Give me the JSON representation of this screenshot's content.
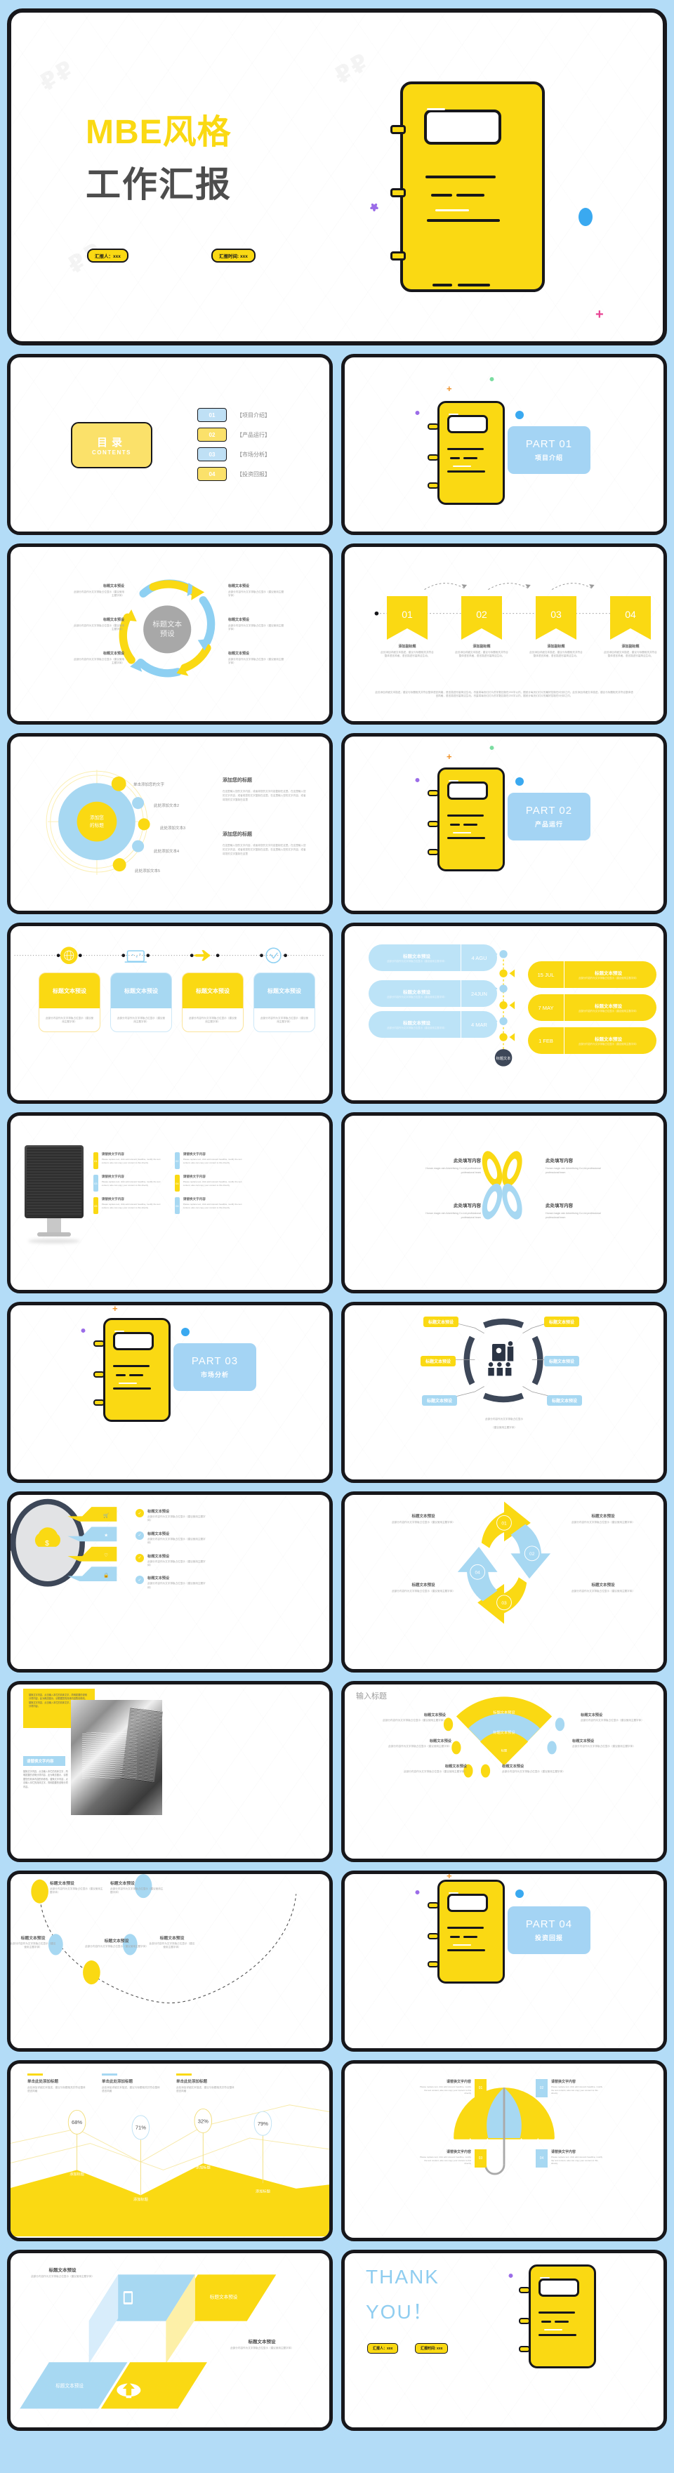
{
  "theme": {
    "yellow": "#fad913",
    "blue": "#a4d4f4",
    "dark": "#17171b",
    "bg": "#b3dcf7",
    "gray": "#8f8f8f"
  },
  "cover": {
    "title_yellow": "MBE风格",
    "title_dark": "工作汇报",
    "tag_presenter": "汇报人：xxx",
    "tag_date": "汇报时间: xxx"
  },
  "contents": {
    "label_cn": "目录",
    "label_en": "CONTENTS",
    "items": [
      {
        "num": "01",
        "text": "【项目介绍】",
        "color": "blue"
      },
      {
        "num": "02",
        "text": "【产品运行】",
        "color": "yellow"
      },
      {
        "num": "03",
        "text": "【市场分析】",
        "color": "blue"
      },
      {
        "num": "04",
        "text": "【投资回报】",
        "color": "yellow"
      }
    ]
  },
  "parts": [
    {
      "num": "PART 01",
      "title": "项目介绍"
    },
    {
      "num": "PART 02",
      "title": "产品运行"
    },
    {
      "num": "PART 03",
      "title": "市场分析"
    },
    {
      "num": "PART 04",
      "title": "投资回报"
    }
  ],
  "common": {
    "preset_title": "标题文本预设",
    "preset_body": "此部分内容作为文字排版占位显示（建议使用主题字体）",
    "preset_body_l1": "此部分内容作为文字排版占",
    "preset_body_l2": "位显示（建议使用主题字体）",
    "add_subtitle": "添加副标题",
    "add_title": "添加标题",
    "replace_text": "请替换文字内容",
    "fill_here": "此处填写内容",
    "input_title": "输入标题",
    "your_title": "添加您的标题",
    "click_add_text": "单击添加您的文字",
    "detail_desc": "此处添加详细文本描述，建议与标题相关并符合整体语言风格，语言描述尽量简洁生动。",
    "en_body": "Please replace text, click add relevant headline, modify the text content, also can copy your content to this directly",
    "en_team": "Hunan magic rain Advertising Co.Ltd.professional professional team"
  },
  "swirl_slide": {
    "center": "标题文本\n预设",
    "items": [
      {
        "title": "标题文本预设",
        "body": "此部分内容作为文字排版占位显示（建议使用主题字体）"
      },
      {
        "title": "标题文本预设",
        "body": "此部分内容作为文字排版占位显示（建议使用主题字体）"
      },
      {
        "title": "标题文本预设",
        "body": "此部分内容作为文字排版占位显示（建议使用主题字体）"
      },
      {
        "title": "标题文本预设",
        "body": "此部分内容作为文字排版占位显示（建议使用主题字体）"
      },
      {
        "title": "标题文本预设",
        "body": "此部分内容作为文字排版占位显示（建议使用主题字体）"
      },
      {
        "title": "标题文本预设",
        "body": "此部分内容作为文字排版占位显示（建议使用主题字体）"
      }
    ]
  },
  "banner_slide": {
    "items": [
      {
        "num": "01",
        "subtitle": "添加副标题",
        "body": "此处添加详细文本描述，建议与标题相关并符合整体语言风格，语言描述尽量简洁生动。"
      },
      {
        "num": "02",
        "subtitle": "添加副标题",
        "body": "此处添加详细文本描述，建议与标题相关并符合整体语言风格，语言描述尽量简洁生动。"
      },
      {
        "num": "03",
        "subtitle": "添加副标题",
        "body": "此处添加详细文本描述，建议与标题相关并符合整体语言风格，语言描述尽量简洁生动。"
      },
      {
        "num": "04",
        "subtitle": "添加副标题",
        "body": "此处添加详细文本描述，建议与标题相关并符合整体语言风格，语言描述尽量简洁生动。"
      }
    ],
    "footer": "此处添加详细文本描述，建议与标题相关并符合整体语言风格，语言描述尽量简洁生动。尽量将每页幻灯片的字数控制在200字以内，据统计每页幻灯片的最好控制在5分钟之内。此处添加详细文本描述，建议与标题相关并符合整体语言风格，语言描述尽量简洁生动。尽量将每页幻灯片的字数控制在200字以内，据统计每页幻灯片的最好控制在5分钟之内。"
  },
  "bubble_slide": {
    "center": "添加您\n的标题",
    "labels": [
      {
        "text": "单击添加您的文字",
        "color": "yellow"
      },
      {
        "text": "此处添加文本2",
        "color": "blue"
      },
      {
        "text": "此处添加文本3",
        "color": "yellow"
      },
      {
        "text": "此处添加文本4",
        "color": "blue"
      },
      {
        "text": "此处添加文本5",
        "color": "yellow"
      }
    ],
    "blocks": [
      {
        "title": "添加您的标题",
        "body": "在这里输入您的文字内容，或者将您的文字内容复制在这里。在这里输入您的文字内容，或者将您的文字复制在这里。在这里输入您的文字内容。或者将您的文字复制在这里"
      },
      {
        "title": "添加您的标题",
        "body": "在这里输入您的文字内容，或者将您的文字内容复制在这里。在这里输入您的文字内容，或者将您的文字复制在这里。在这里输入您的文字内容。或者将您的文字复制在这里"
      }
    ]
  },
  "icon_timeline": {
    "cards": [
      {
        "title": "标题文本预设",
        "body": "此部分内容作为文字排版占位显示（建议使用主题字体）",
        "color": "yellow",
        "icon": "globe-icon"
      },
      {
        "title": "标题文本预设",
        "body": "此部分内容作为文字排版占位显示（建议使用主题字体）",
        "color": "blue",
        "icon": "laptop-icon"
      },
      {
        "title": "标题文本预设",
        "body": "此部分内容作为文字排版占位显示（建议使用主题字体）",
        "color": "yellow",
        "icon": "airplane-icon"
      },
      {
        "title": "标题文本预设",
        "body": "此部分内容作为文字排版占位显示（建议使用主题字体）",
        "color": "blue",
        "icon": "clock-icon"
      }
    ]
  },
  "date_timeline": {
    "center_label": "标题文本",
    "left": [
      {
        "date": "4 AGU",
        "title": "标题文本预设",
        "body": "此部分内容作为文字排版占位显示（建议使用主题字体）"
      },
      {
        "date": "24JUN",
        "title": "标题文本预设",
        "body": "此部分内容作为文字排版占位显示（建议使用主题字体）"
      },
      {
        "date": "4 MAR",
        "title": "标题文本预设",
        "body": "此部分内容作为文字排版占位显示（建议使用主题字体）"
      }
    ],
    "right": [
      {
        "date": "15 JUL",
        "title": "标题文本预设",
        "body": "此部分内容作为文字排版占位显示（建议使用主题字体）"
      },
      {
        "date": "7 MAY",
        "title": "标题文本预设",
        "body": "此部分内容作为文字排版占位显示（建议使用主题字体）"
      },
      {
        "date": "1 FEB",
        "title": "标题文本预设",
        "body": "此部分内容作为文字排版占位显示（建议使用主题字体）"
      }
    ]
  },
  "monitor_slide": {
    "items": [
      {
        "num": "01",
        "title": "请替换文字内容",
        "body": "Please replace text, click add relevant headline, modify the text content, also can copy your content to this directly",
        "color": "yellow"
      },
      {
        "num": "02",
        "title": "请替换文字内容",
        "body": "Please replace text, click add relevant headline, modify the text content, also can copy your content to this directly",
        "color": "blue"
      },
      {
        "num": "03",
        "title": "请替换文字内容",
        "body": "Please replace text, click add relevant headline, modify the text content, also can copy your content to this directly",
        "color": "blue"
      },
      {
        "num": "04",
        "title": "请替换文字内容",
        "body": "Please replace text, click add relevant headline, modify the text content, also can copy your content to this directly",
        "color": "yellow"
      },
      {
        "num": "05",
        "title": "请替换文字内容",
        "body": "Please replace text, click add relevant headline, modify the text content, also can copy your content to this directly",
        "color": "yellow"
      },
      {
        "num": "06",
        "title": "请替换文字内容",
        "body": "Please replace text, click add relevant headline, modify the text content, also can copy your content to this directly",
        "color": "blue"
      }
    ]
  },
  "petal_slide": {
    "items": [
      {
        "title": "此处填写内容",
        "body": "Hunan magic rain Advertising Co.Ltd.professional professional team"
      },
      {
        "title": "此处填写内容",
        "body": "Hunan magic rain Advertising Co.Ltd.professional professional team"
      },
      {
        "title": "此处填写内容",
        "body": "Hunan magic rain Advertising Co.Ltd.professional professional team"
      },
      {
        "title": "此处填写内容",
        "body": "Hunan magic rain Advertising Co.Ltd.professional professional team"
      }
    ]
  },
  "hub_slide": {
    "tags": [
      {
        "text": "标题文本预设",
        "color": "yellow"
      },
      {
        "text": "标题文本预设",
        "color": "yellow"
      },
      {
        "text": "标题文本预设",
        "color": "yellow"
      },
      {
        "text": "标题文本预设",
        "color": "blue"
      },
      {
        "text": "标题文本预设",
        "color": "blue"
      },
      {
        "text": "标题文本预设",
        "color": "blue"
      }
    ],
    "caption_l1": "此部分内容作为文字排版占位显示",
    "caption_l2": "（建议使用主题字体）"
  },
  "magnifier_slide": {
    "items": [
      {
        "title": "标题文本预设",
        "body": "此部分内容作为文字排版占位显示（建议使用主题字体）",
        "color": "yellow"
      },
      {
        "title": "标题文本预设",
        "body": "此部分内容作为文字排版占位显示（建议使用主题字体）",
        "color": "blue"
      },
      {
        "title": "标题文本预设",
        "body": "此部分内容作为文字排版占位显示（建议使用主题字体）",
        "color": "yellow"
      },
      {
        "title": "标题文本预设",
        "body": "此部分内容作为文字排版占位显示（建议使用主题字体）",
        "color": "blue"
      }
    ]
  },
  "cycle_slide": {
    "items": [
      {
        "num": "01",
        "title": "标题文本预设",
        "body": "此部分内容作为文字排版占位显示（建议使用主题字体）",
        "color": "yellow"
      },
      {
        "num": "02",
        "title": "标题文本预设",
        "body": "此部分内容作为文字排版占位显示（建议使用主题字体）",
        "color": "blue"
      },
      {
        "num": "03",
        "title": "标题文本预设",
        "body": "此部分内容作为文字排版占位显示（建议使用主题字体）",
        "color": "yellow"
      },
      {
        "num": "04",
        "title": "标题文本预设",
        "body": "此部分内容作为文字排版占位显示（建议使用主题字体）",
        "color": "blue"
      }
    ]
  },
  "photo_slide": {
    "yellow_block": "替换文字内容、点击输入本栏的具体文字，简明扼要的说明分项内容，此为概念图示，请根据您的具体内容酌情修改。替换文字内容、点击输入本栏的具体文字，简明扼要的说明分项内容。",
    "blue_title": "请替换文字内容",
    "blue_body": "替换文字内容，点击输入本栏的具体文字，简明扼要的说明分项内容，此为概念图示，请根据您的具体内容酌情修改。替换文字内容，点击输入本栏的具体文字，简明扼要的说明分项内容。"
  },
  "fan_slide": {
    "heading": "输入标题",
    "fan_labels": [
      "标题文本预设",
      "标题文本预设",
      "标题"
    ],
    "items": [
      {
        "title": "标题文本预设",
        "body": "此部分内容作为文字排版占位显示（建议使用主题字体）",
        "color": "yellow"
      },
      {
        "title": "标题文本预设",
        "body": "此部分内容作为文字排版占位显示（建议使用主题字体）",
        "color": "blue"
      },
      {
        "title": "标题文本预设",
        "body": "此部分内容作为文字排版占位显示（建议使用主题字体）",
        "color": "yellow"
      },
      {
        "title": "标题文本预设",
        "body": "此部分内容作为文字排版占位显示（建议使用主题字体）",
        "color": "blue"
      },
      {
        "title": "标题文本预设",
        "body": "此部分内容作为文字排版占位显示（建议使用主题字体）",
        "color": "yellow"
      },
      {
        "title": "标题文本预设",
        "body": "此部分内容作为文字排版占位显示（建议使用主题字体）",
        "color": "yellow"
      }
    ]
  },
  "arc_slide": {
    "items": [
      {
        "title": "标题文本预设",
        "body": "此部分内容作为文字排版占位显示（建议使用主题字体）",
        "color": "yellow"
      },
      {
        "title": "标题文本预设",
        "body": "此部分内容作为文字排版占位显示（建议使用主题字体）",
        "color": "blue"
      },
      {
        "title": "标题文本预设",
        "body": "此部分内容作为文字排版占位显示（建议使用主题字体）",
        "color": "blue"
      },
      {
        "title": "标题文本预设",
        "body": "此部分内容作为文字排版占位显示（建议使用主题字体）",
        "color": "blue"
      },
      {
        "title": "标题文本预设",
        "body": "此部分内容作为文字排版占位显示（建议使用主题字体）",
        "color": "yellow"
      }
    ]
  },
  "chart_data": {
    "type": "line",
    "title": "",
    "categories": [
      "添加标题",
      "添加标题",
      "添加标题",
      "添加标题"
    ],
    "values": [
      68,
      71,
      32,
      79
    ],
    "value_labels": [
      "68%",
      "71%",
      "32%",
      "79%"
    ],
    "ylabel": "",
    "xlabel": "",
    "ylim": [
      0,
      100
    ],
    "grid": false,
    "legend": "none",
    "headers": [
      {
        "title": "单击此处添加标题",
        "body": "此处添加详细文本描述，建议与标题相关并符合整体语言风格",
        "color": "yellow"
      },
      {
        "title": "单击此处添加标题",
        "body": "此处添加详细文本描述，建议与标题相关并符合整体语言风格",
        "color": "blue"
      },
      {
        "title": "单击此处添加标题",
        "body": "此处添加详细文本描述，建议与标题相关并符合整体语言风格",
        "color": "yellow"
      }
    ]
  },
  "umbrella_slide": {
    "items": [
      {
        "num": "01",
        "title": "请替换文字内容",
        "body": "Please replace text, click add relevant headline, modify the text content, also can copy your content to this directly",
        "color": "yellow"
      },
      {
        "num": "02",
        "title": "请替换文字内容",
        "body": "Please replace text, click add relevant headline, modify the text content, also can copy your content to this directly",
        "color": "blue"
      },
      {
        "num": "03",
        "title": "请替换文字内容",
        "body": "Please replace text, click add relevant headline, modify the text content, also can copy your content to this directly",
        "color": "yellow"
      },
      {
        "num": "04",
        "title": "请替换文字内容",
        "body": "Please replace text, click add relevant headline, modify the text content, also can copy your content to this directly",
        "color": "blue"
      }
    ]
  },
  "iso_slide": {
    "items": [
      {
        "title": "标题文本预设",
        "body": "此部分内容作为文字排版占位显示（建议使用主题字体）",
        "color": "blue",
        "icon": "tablet-icon"
      },
      {
        "title": "标题文本预设",
        "body": "",
        "color": "yellow",
        "icon": ""
      },
      {
        "title": "标题文本预设",
        "body": "",
        "color": "blue",
        "icon": ""
      },
      {
        "title": "标题文本预设",
        "body": "此部分内容作为文字排版占位显示（建议使用主题字体）",
        "color": "yellow",
        "icon": "cloud-upload-icon"
      }
    ]
  },
  "thanks": {
    "line1": "THANK",
    "line2": "YOU！",
    "tag_presenter": "汇报人：xxx",
    "tag_date": "汇报时间: xxx"
  }
}
